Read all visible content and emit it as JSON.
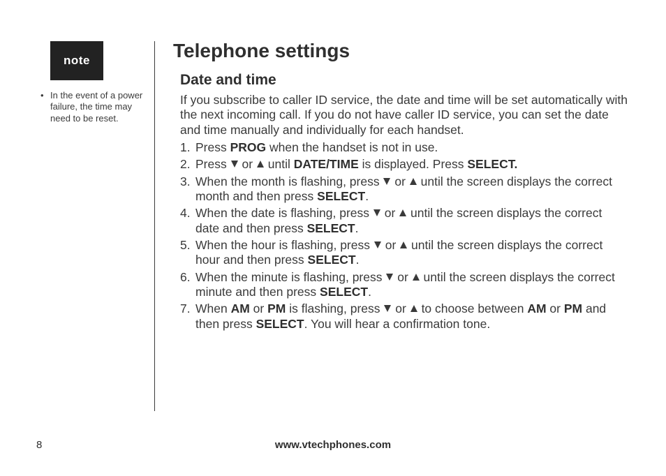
{
  "note": {
    "badge": "note",
    "items": [
      "In the event of a power failure, the time may need to be reset."
    ]
  },
  "page": {
    "title": "Telephone settings",
    "section_title": "Date and time",
    "intro": "If you subscribe to caller ID service, the date and time will be set automatically with the next incoming call. If you do not have caller ID service, you can set the date and time manually and individually for each handset.",
    "page_number": "8",
    "footer_url": "www.vtechphones.com"
  },
  "keys": {
    "prog": "PROG",
    "datetime": "DATE/TIME",
    "select": "SELECT",
    "select_dot": "SELECT.",
    "am": "AM",
    "pm": "PM"
  },
  "steps": {
    "s1_a": "Press ",
    "s1_b": " when the handset is not in use.",
    "s2_a": "Press ",
    "s2_b": " or ",
    "s2_c": " until ",
    "s2_d": " is displayed. Press ",
    "s3_a": "When the month is flashing, press ",
    "s3_b": " or ",
    "s3_c": " until the screen displays the correct month and then press ",
    "s4_a": "When the date is flashing, press ",
    "s4_b": " or ",
    "s4_c": " until the screen displays the correct date and then press ",
    "s5_a": "When the hour is flashing, press ",
    "s5_b": " or ",
    "s5_c": " until the screen displays the correct hour and then press ",
    "s6_a": "When the minute is flashing, press ",
    "s6_b": " or ",
    "s6_c": " until the screen displays the correct minute and then press ",
    "s7_a": "When ",
    "s7_b": " or ",
    "s7_c": " is flashing, press ",
    "s7_d": " or ",
    "s7_e": " to choose between ",
    "s7_f": " or ",
    "s7_g": " and then press ",
    "s7_h": ". You will hear a confirmation tone."
  },
  "nums": {
    "n1": "1.",
    "n2": "2.",
    "n3": "3.",
    "n4": "4.",
    "n5": "5.",
    "n6": "6.",
    "n7": "7."
  }
}
